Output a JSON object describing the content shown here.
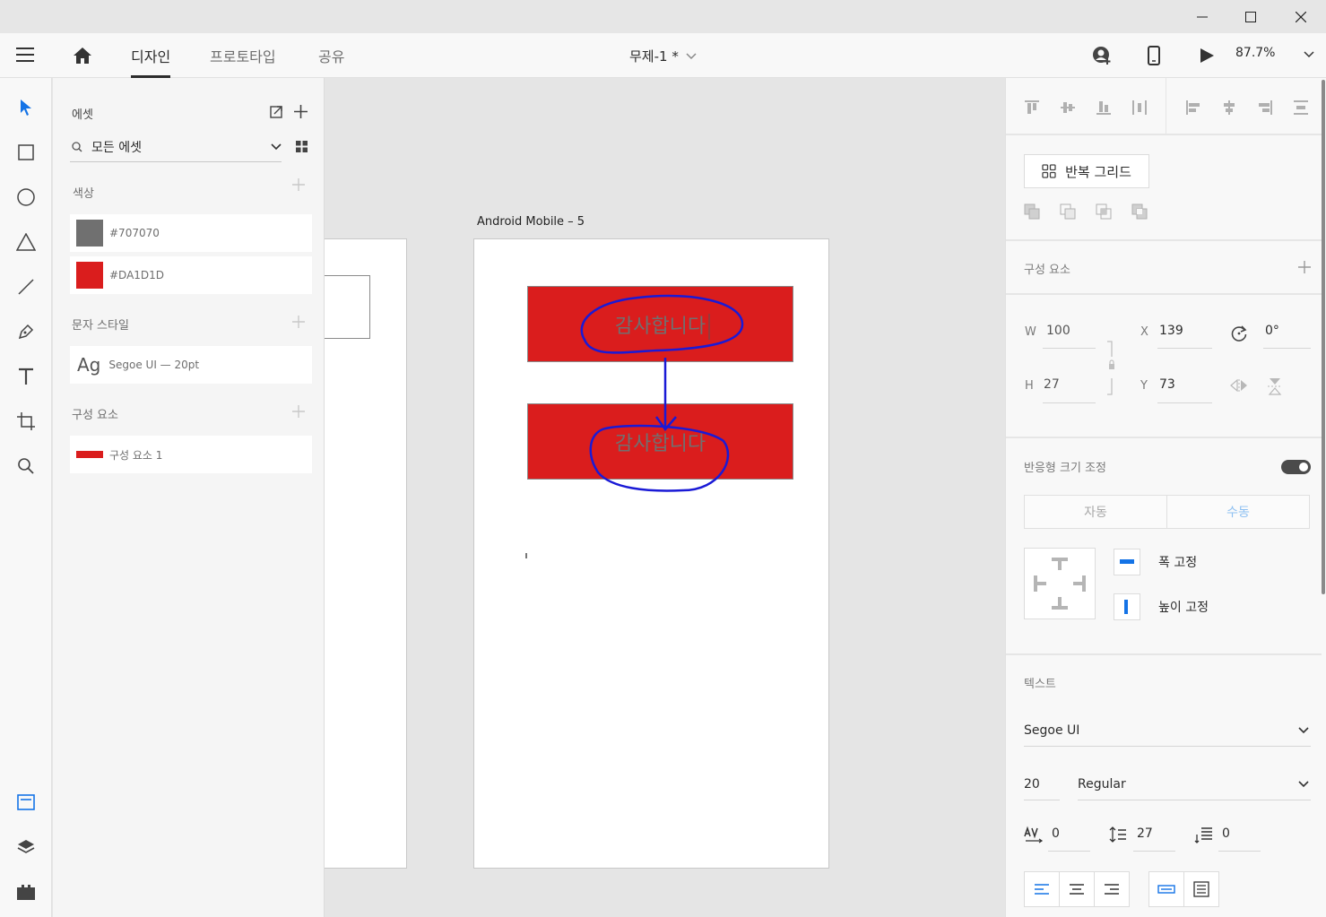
{
  "window": {
    "minimize_icon": "minimize-icon",
    "maximize_icon": "maximize-icon",
    "close_icon": "close-icon"
  },
  "toolbar": {
    "tabs": [
      {
        "label": "디자인",
        "active": true
      },
      {
        "label": "프로토타입",
        "active": false
      },
      {
        "label": "공유",
        "active": false
      }
    ],
    "document_title": "무제-1 *",
    "zoom": "87.7%"
  },
  "assets": {
    "title": "에셋",
    "search_value": "모든 에셋",
    "colors_title": "색상",
    "colors": [
      {
        "hex": "#707070",
        "label": "#707070"
      },
      {
        "hex": "#DA1D1D",
        "label": "#DA1D1D"
      }
    ],
    "char_styles_title": "문자 스타일",
    "char_style": {
      "sample": "Ag",
      "label": "Segoe UI — 20pt"
    },
    "components_title": "구성 요소",
    "components": [
      {
        "label": "구성 요소 1"
      }
    ]
  },
  "canvas": {
    "artboard_label": "Android Mobile – 5",
    "box1_text": "감사합니다",
    "box2_text": "감사합니다",
    "accent_red": "#da1d1d",
    "annotation_color": "#1a1ad6"
  },
  "props": {
    "repeat_grid_label": "반복 그리드",
    "component_title": "구성 요소",
    "w_label": "W",
    "w_value": "100",
    "h_label": "H",
    "h_value": "27",
    "x_label": "X",
    "x_value": "139",
    "y_label": "Y",
    "y_value": "73",
    "rotation_value": "0°",
    "responsive_title": "반응형 크기 조정",
    "responsive_on": true,
    "seg_auto": "자동",
    "seg_manual": "수동",
    "fix_width_label": "폭 고정",
    "fix_height_label": "높이 고정",
    "text_title": "텍스트",
    "font_family": "Segoe UI",
    "font_size": "20",
    "font_weight": "Regular",
    "char_spacing": "0",
    "line_spacing": "27",
    "para_spacing": "0",
    "accent_blue": "#1473e6"
  }
}
